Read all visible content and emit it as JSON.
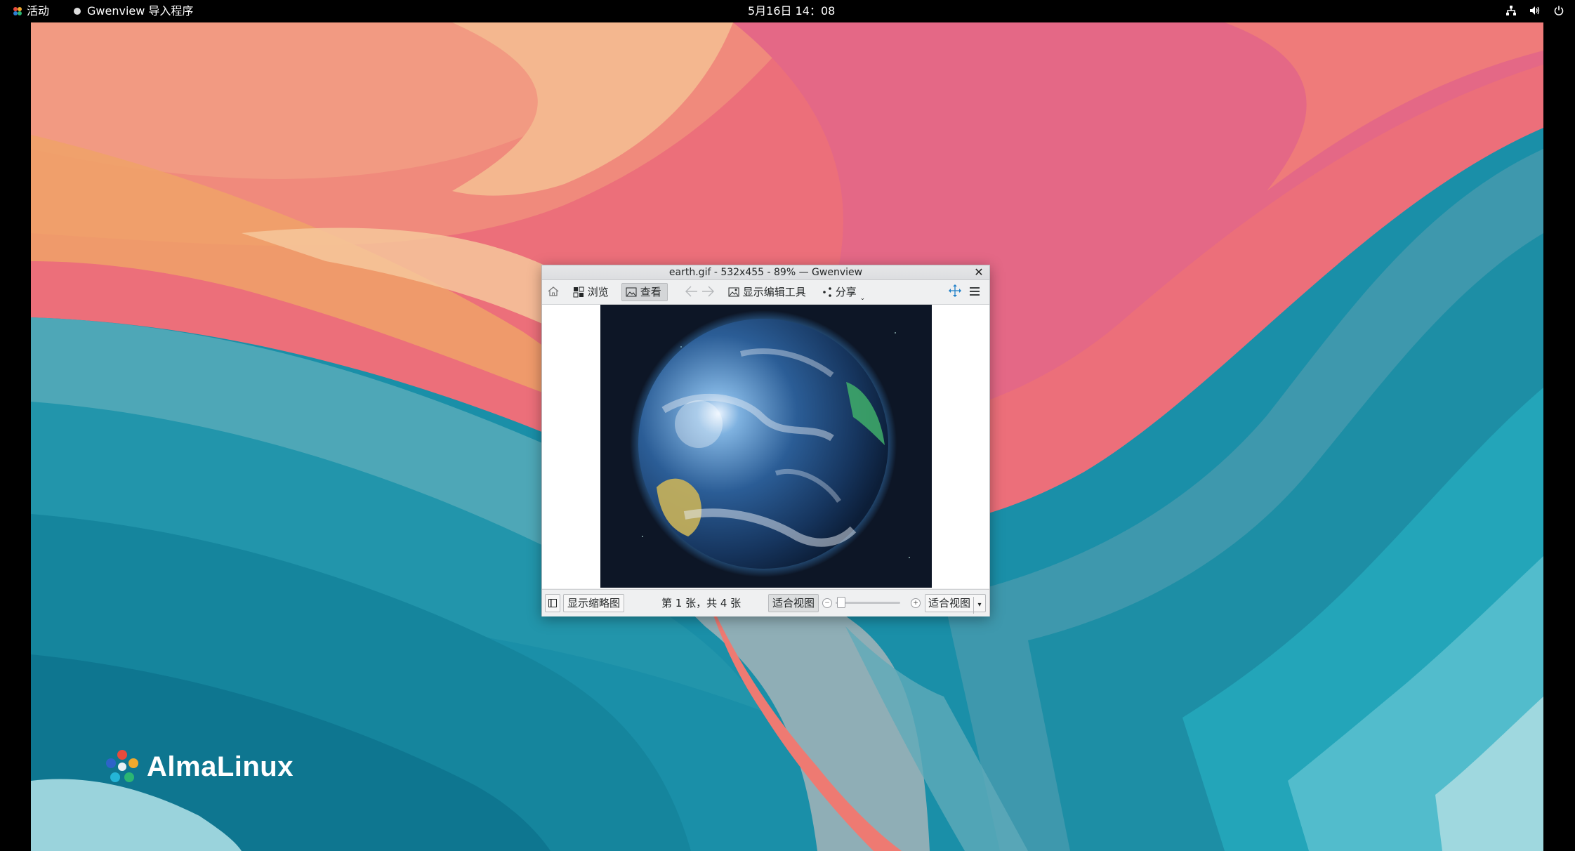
{
  "topbar": {
    "activities": "活动",
    "app_menu": "Gwenview 导入程序",
    "clock": "5月16日  14：08",
    "icons": [
      "network-icon",
      "volume-icon",
      "power-icon"
    ]
  },
  "desktop": {
    "brand": "AlmaLinux",
    "colors": {
      "teal": "#1a8fa8",
      "coral": "#ef7a78",
      "peach": "#f2b48e",
      "pink": "#e26d8c"
    }
  },
  "window": {
    "title": "earth.gif - 532x455 - 89%  — Gwenview",
    "toolbar": {
      "browse": "浏览",
      "view": "查看",
      "edit_tools": "显示编辑工具",
      "share": "分享"
    },
    "statusbar": {
      "show_thumbnails": "显示缩略图",
      "image_count": "第 1 张，共 4 张",
      "fit_view": "适合视图",
      "zoom_select": "适合视图"
    },
    "image": {
      "name": "earth.gif",
      "zoom": "89%"
    }
  }
}
